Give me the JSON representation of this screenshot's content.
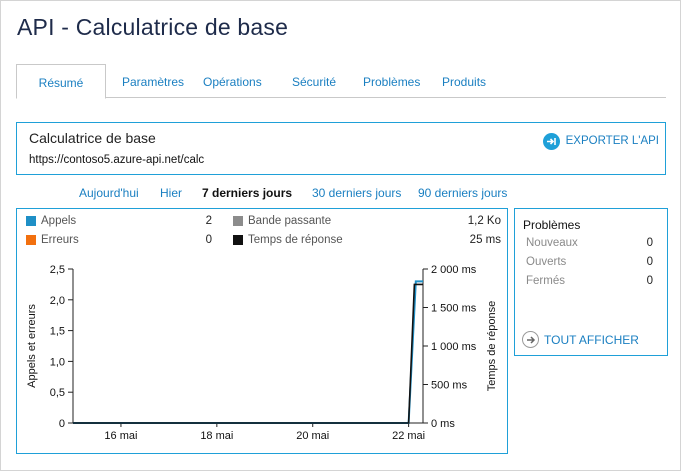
{
  "page": {
    "title": "API - Calculatrice de base"
  },
  "tabs": [
    {
      "label": "Résumé",
      "active": true
    },
    {
      "label": "Paramètres"
    },
    {
      "label": "Opérations"
    },
    {
      "label": "Sécurité"
    },
    {
      "label": "Problèmes"
    },
    {
      "label": "Produits"
    }
  ],
  "api": {
    "name": "Calculatrice de base",
    "url": "https://contoso5.azure-api.net/calc",
    "export_label": "EXPORTER L'API"
  },
  "ranges": [
    {
      "label": "Aujourd'hui"
    },
    {
      "label": "Hier"
    },
    {
      "label": "7 derniers jours",
      "active": true
    },
    {
      "label": "30 derniers jours"
    },
    {
      "label": "90 derniers jours"
    }
  ],
  "legend": {
    "calls": {
      "label": "Appels",
      "value": "2",
      "color": "#1e8fc6"
    },
    "errors": {
      "label": "Erreurs",
      "value": "0",
      "color": "#f2700f"
    },
    "bandwidth": {
      "label": "Bande passante",
      "value": "1,2 Ko",
      "color": "#8c8c8c"
    },
    "response": {
      "label": "Temps de réponse",
      "value": "25 ms",
      "color": "#111111"
    }
  },
  "chart_data": {
    "type": "line",
    "ylabel": "Appels et erreurs",
    "y2label": "Temps de réponse",
    "ylim": [
      0,
      2.5
    ],
    "y2lim": [
      0,
      2000
    ],
    "yticks": [
      "0",
      "0,5",
      "1,0",
      "1,5",
      "2,0",
      "2,5"
    ],
    "y2ticks": [
      "0 ms",
      "500 ms",
      "1 000 ms",
      "1 500 ms",
      "2 000 ms"
    ],
    "xticks": [
      "16 mai",
      "18 mai",
      "20 mai",
      "22 mai"
    ],
    "xtick_days": [
      16,
      18,
      20,
      22
    ],
    "xlim": [
      15,
      22.3
    ],
    "series": [
      {
        "name": "Appels",
        "color": "#1e8fc6",
        "x": [
          15,
          22.0,
          22.15,
          22.3
        ],
        "y": [
          0,
          0,
          2.3,
          2.3
        ]
      },
      {
        "name": "Temps de réponse",
        "color": "#111111",
        "x": [
          15,
          22.0,
          22.12,
          22.3
        ],
        "y": [
          0,
          0,
          1800,
          1800
        ]
      }
    ]
  },
  "problems": {
    "title": "Problèmes",
    "rows": [
      {
        "label": "Nouveaux",
        "value": "0"
      },
      {
        "label": "Ouverts",
        "value": "0"
      },
      {
        "label": "Fermés",
        "value": "0"
      }
    ],
    "show_all": "TOUT AFFICHER"
  }
}
